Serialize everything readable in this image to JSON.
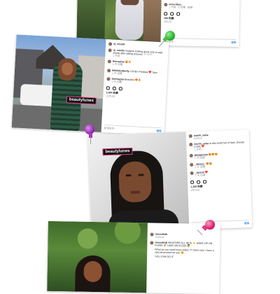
{
  "posts": [
    {
      "id": "post1",
      "username": "anna.bbyz",
      "meta": "1 天前 · 1 回覆 · 翻譯",
      "likes": "189 則讚",
      "date": "4月2日",
      "add_comment": "新增留言⋯",
      "post_label": "發佈"
    },
    {
      "id": "post2",
      "username": "nj_xmellx",
      "tag": "beautylunes",
      "caption_user": "nj_xmellx",
      "caption": "Imagine looking good only to wait slowly after taking pictures 🤍🤍🤍",
      "caption_meta": "1 天前",
      "comments": [
        {
          "user": "therealme",
          "text": "😍🔥",
          "meta": "1 天 回覆"
        },
        {
          "user": "kikiitsbutterfly",
          "text": "LOVE!! Prettiest ❤️ face",
          "meta": "1 天 回覆"
        },
        {
          "user": "beemayaa",
          "text": "Beautiful 😍🔥",
          "meta": "1 天 回覆"
        }
      ],
      "likes": "1,084 則讚",
      "date": "12月2日",
      "add_comment": "新增留言⋯",
      "post_label": "發佈"
    },
    {
      "id": "post3",
      "username": "naomi_asha",
      "subtitle": "Sunrise",
      "tag": "beautylunes",
      "caption_user": "naomi_asha",
      "caption": "In this world full of hate, choose LOVE ❤️",
      "caption_meta": "1 天前",
      "comments": [
        {
          "user": "jbergamine",
          "text": "😍😍😍",
          "meta": "1 天 回覆"
        },
        {
          "user": "_alexus_",
          "text": "😍😍",
          "meta": "1 天 回覆"
        },
        {
          "user": "_jessnii",
          "text": "❤️",
          "meta": "1 天 回覆"
        }
      ],
      "likes": "1,389 則讚",
      "date": "3月14日",
      "add_comment": "新增留言⋯",
      "post_label": "發佈"
    },
    {
      "id": "post4",
      "username": "missallatb",
      "subtitle": "Sanjuan",
      "caption_user": "missallatb",
      "caption": "WEATHER ALL NICE ☀️ MAKE UP ON FLEEK 💅 HAIR ON FLEEK 💇",
      "caption2": "What do you need more ladies ?? that's why I have a special present for you 😘",
      "caption3": "YOU CAN DO IT"
    }
  ]
}
